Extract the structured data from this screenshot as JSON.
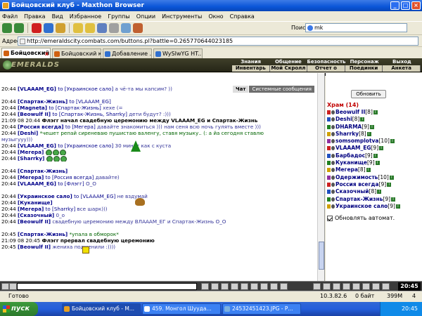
{
  "window": {
    "title": "Бойцовский клуб - Maxthon Browser"
  },
  "menu": [
    "Файл",
    "Правка",
    "Вид",
    "Избранное",
    "Группы",
    "Опции",
    "Инструменты",
    "Окно",
    "Справка"
  ],
  "search": {
    "label": "Поиск",
    "value": "mk"
  },
  "address": {
    "label": "Адрес",
    "url": "http://emeraldscity.combats.com/buttons.pl?battle=0.265770644023185"
  },
  "tabs": [
    "Бойцовский...",
    "Бойцовский к...",
    "Добавление ...",
    "WySIwYG HT..."
  ],
  "game": {
    "logo": "EMERALDS",
    "nav_top": [
      "Знания",
      "Общение",
      "Безопасность",
      "Персонаж",
      "Выход"
    ],
    "nav_bottom": [
      "Инвентарь",
      "Мой Скролл",
      "Отчет о переводах",
      "Поединки",
      "Анкета"
    ]
  },
  "chat": {
    "tabs": [
      "Чат",
      "Системные сообщения"
    ],
    "messages": [
      {
        "t": "20:44",
        "n": "[VLAAAM_EG]",
        "to": "to [Украинское сало]",
        "tx": "а чё-та мы капсим? ))"
      },
      {
        "t": "",
        "n": "",
        "to": "",
        "tx": ""
      },
      {
        "t": "20:44",
        "n": "[Спартак-Жизнь]",
        "to": "to [VLAAAM_EG]",
        "tx": ""
      },
      {
        "t": "20:44",
        "n": "[Magneta]",
        "to": "to [Спартак-Жизнь]",
        "tx": "хехе (="
      },
      {
        "t": "20:44",
        "n": "[Beowulf II]",
        "to": "to [Спартак-Жизнь, Sharrky]",
        "tx": "дети будут? :)))"
      },
      {
        "t": "21:09 08 20:44",
        "n": "Флэгг",
        "to": "",
        "tx": "начал свадебную церемонию между VLAAAM_EG и Спартак-Жизнь",
        "sys": true
      },
      {
        "t": "20:44",
        "n": "[Россия всегда]",
        "to": "to [Мегера]",
        "tx": "давайте знакомиться ))) нам сеня всю ночь гулять вместе )))"
      },
      {
        "t": "20:44",
        "n": "[Deshi]",
        "to": "",
        "tx": "*чешет репай сиреневаю пушистаю валенгу, ставя музыку.. (: а йа сегодня ставлю",
        "emo": true
      },
      {
        "t": "",
        "n": "",
        "to": "",
        "tx": "музыгууу)))"
      },
      {
        "t": "20:44",
        "n": "[VLAAAM_EG]",
        "to": "to [Украинское сало]",
        "tx": "30 минут как с куста"
      },
      {
        "t": "20:44",
        "n": "[Мегера]",
        "to": "",
        "tx": "",
        "smiles": 3
      },
      {
        "t": "20:44",
        "n": "[Sharrky]",
        "to": "",
        "tx": "",
        "smiles": 3
      },
      {
        "t": "",
        "n": "",
        "to": "",
        "tx": ""
      },
      {
        "t": "20:44",
        "n": "[Спартак-Жизнь]",
        "to": "",
        "tx": ""
      },
      {
        "t": "20:44",
        "n": "[Мегера]",
        "to": "to [Россия всегда]",
        "tx": "давайте)"
      },
      {
        "t": "20:44",
        "n": "[VLAAAM_EG]",
        "to": "to [Флэгг]",
        "tx": "O_O"
      },
      {
        "t": "",
        "n": "",
        "to": "",
        "tx": ""
      },
      {
        "t": "20:44",
        "n": "[Украинское сало]",
        "to": "to [VLAAAM_EG]",
        "tx": "               не вздумай"
      },
      {
        "t": "20:44",
        "n": "[Куканище]",
        "to": "",
        "tx": ""
      },
      {
        "t": "20:44",
        "n": "[Мегера]",
        "to": "to [Sharrky]",
        "tx": "все шарк)))"
      },
      {
        "t": "20:44",
        "n": "[Сказочный]",
        "to": "",
        "tx": "0_о"
      },
      {
        "t": "20:44",
        "n": "[Beowulf II]",
        "to": "",
        "tx": "свадебную церемонию между ВЛАААМ_ЕГ и Спартак-Жизнь О_О"
      },
      {
        "t": "",
        "n": "",
        "to": "",
        "tx": ""
      },
      {
        "t": "20:45",
        "n": "[Спартак-Жизнь]",
        "to": "",
        "tx": "      *упала в обморок*",
        "emo": true
      },
      {
        "t": "21:09 08 20:45",
        "n": "Флэгг",
        "to": "",
        "tx": "прервал свадебную церемонию",
        "sys": true
      },
      {
        "t": "20:45",
        "n": "[Beowulf II]",
        "to": "",
        "tx": "жениха подменили :))))"
      }
    ]
  },
  "panel": {
    "refresh": "Обновить",
    "room": "Храм (14)",
    "users": [
      {
        "n": "Beowulf II",
        "l": "[8]"
      },
      {
        "n": "Deshi",
        "l": "[8]"
      },
      {
        "n": "DHARMA",
        "l": "[9]"
      },
      {
        "n": "Sharrky",
        "l": "[8]"
      },
      {
        "n": "somsomplotva",
        "l": "[10]"
      },
      {
        "n": "VLAAAM_EG",
        "l": "[9]"
      },
      {
        "n": "Барбадос",
        "l": "[9]"
      },
      {
        "n": "Куканище",
        "l": "[9]"
      },
      {
        "n": "Мегера",
        "l": "[8]"
      },
      {
        "n": "Одержимость",
        "l": "[10]"
      },
      {
        "n": "Россия всегда",
        "l": "[9]"
      },
      {
        "n": "Сказочный",
        "l": "[8]"
      },
      {
        "n": "Спартак-Жизнь",
        "l": "[9]"
      },
      {
        "n": "Украинское сало",
        "l": "[9]"
      }
    ],
    "auto_label": "Обновлять автомат."
  },
  "clock": "20:45",
  "status": {
    "ready": "Готово",
    "ip": "10.3.82.6",
    "bytes": "0 байт",
    "mem": "399M",
    "num": "4"
  },
  "taskbar": {
    "start": "пуск",
    "tasks": [
      "Бойцовский клуб - M...",
      "459. Монгол Шууда...",
      "24532451423.JPG - Р..."
    ],
    "time": "20:45"
  }
}
